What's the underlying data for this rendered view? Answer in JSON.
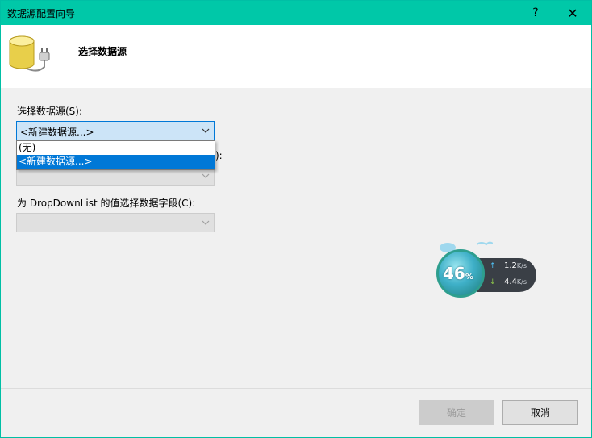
{
  "window": {
    "title": "数据源配置向导",
    "help_label": "?",
    "close_label": "✕"
  },
  "header": {
    "title": "选择数据源"
  },
  "form": {
    "datasource_label": "选择数据源(S):",
    "datasource_value": "<新建数据源...>",
    "datasource_options": [
      "(无)",
      "<新建数据源...>"
    ],
    "hidden_label_tail": "):",
    "value_field_label": "为 DropDownList 的值选择数据字段(C):"
  },
  "buttons": {
    "ok": "确定",
    "cancel": "取消"
  },
  "net_monitor": {
    "percent": "46",
    "percent_sign": "%",
    "upload": "1.2",
    "download": "4.4",
    "unit": "K/s"
  },
  "colors": {
    "titlebar": "#00c8a8",
    "selection": "#0078d7"
  }
}
